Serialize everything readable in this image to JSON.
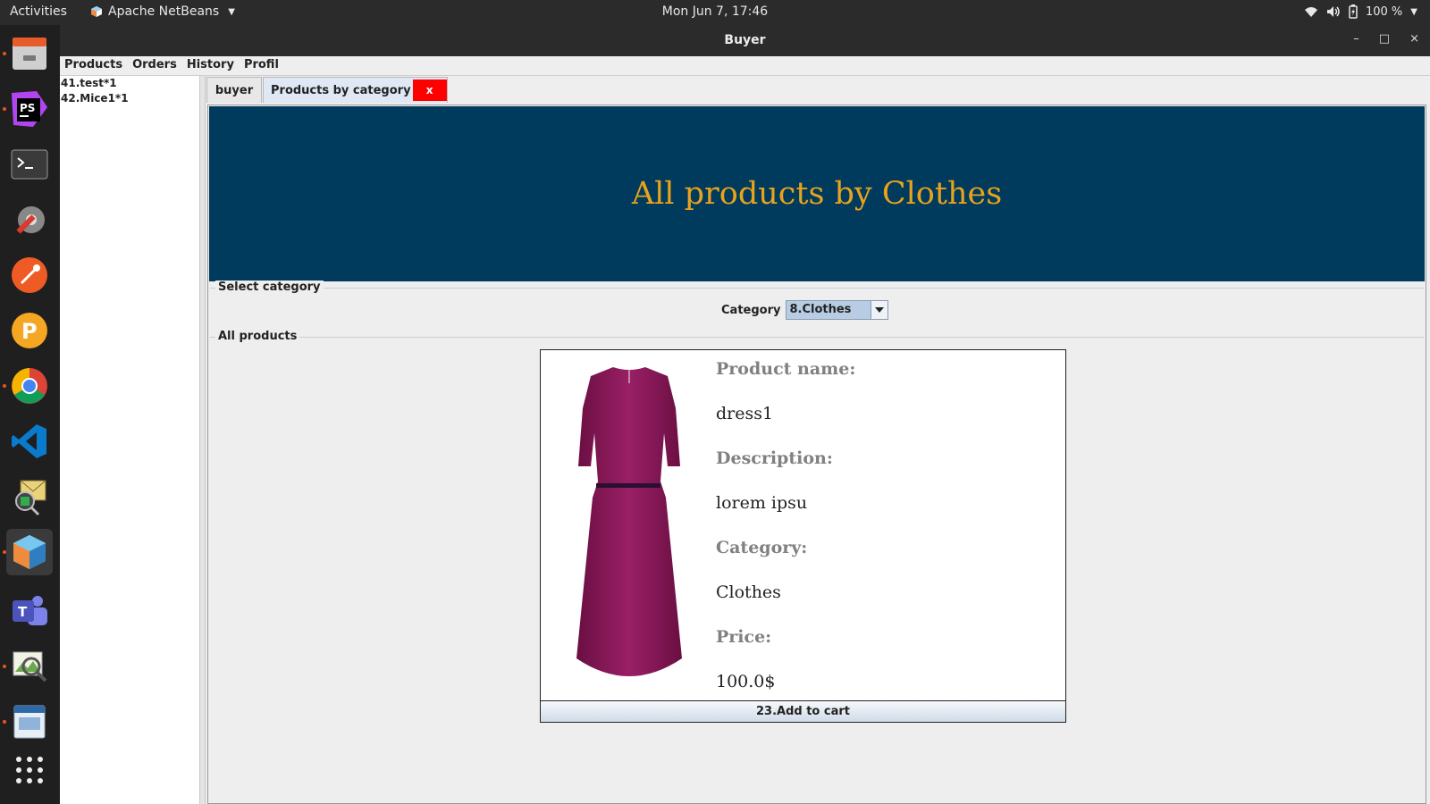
{
  "topbar": {
    "activities": "Activities",
    "app_name": "Apache NetBeans",
    "clock": "Mon Jun  7, 17:46",
    "battery": "100 %"
  },
  "dock": {
    "apps": [
      "file-manager",
      "phpstorm",
      "terminal",
      "settings",
      "postman",
      "pgadmin",
      "chrome",
      "vscode",
      "mail-viewer",
      "netbeans",
      "teams",
      "image-viewer",
      "slides",
      "app-grid"
    ]
  },
  "window": {
    "title": "Buyer",
    "controls": {
      "minimize": "–",
      "maximize": "□",
      "close": "×"
    }
  },
  "menubar": [
    "Products",
    "Orders",
    "History",
    "Profil"
  ],
  "cart_list": [
    "41.test*1",
    "42.Mice1*1"
  ],
  "tabs": {
    "buyer": "buyer",
    "products_by_category": "Products by category",
    "close": "x"
  },
  "banner": {
    "title": "All products by Clothes"
  },
  "select_category": {
    "legend": "Select category",
    "label": "Category",
    "selected": "8.Clothes"
  },
  "all_products": {
    "legend": "All products"
  },
  "product": {
    "name_label": "Product name:",
    "name": "dress1",
    "description_label": "Description:",
    "description": "lorem ipsu",
    "category_label": "Category:",
    "category": "Clothes",
    "price_label": "Price:",
    "price": "100.0$",
    "add_button": "23.Add to cart"
  },
  "colors": {
    "banner_bg": "#003a5c",
    "banner_text": "#e8a31c",
    "close_tab": "#ff0000",
    "dress": "#8c1a5a"
  }
}
